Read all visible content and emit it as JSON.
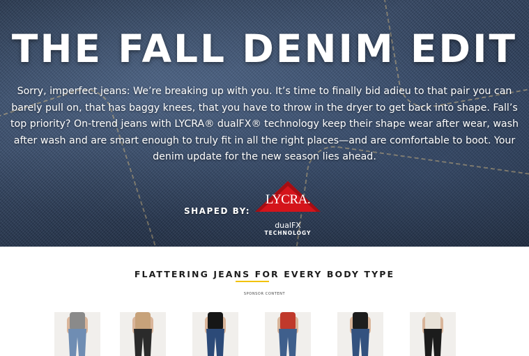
{
  "hero": {
    "title": "THE FALL DENIM EDIT",
    "body": "Sorry, imperfect jeans: We’re breaking up with you. It’s time to finally bid adieu to that pair you can barely pull on, that has baggy knees, that you have to throw in the dryer to get back into shape. Fall’s top priority? On-trend jeans with LYCRA® dualFX® technology keep their shape wear after wear, wash after wash and are smart enough to truly fit in all the right places—and are comfortable to boot. Your denim update for the new season lies ahead.",
    "shaped_by": "SHAPED BY:",
    "logo": {
      "brand": "LYCRA.",
      "line1": "dualFX",
      "line2": "TECHNOLOGY",
      "color": "#d4141b"
    }
  },
  "section": {
    "title": "FLATTERING JEANS FOR EVERY BODY TYPE",
    "sponsor": "SPONSOR CONTENT",
    "accent": "#f2c200"
  },
  "products": [
    {
      "name": "product-1",
      "top_color": "#8a8a8a",
      "jean_color": "#6f8db3"
    },
    {
      "name": "product-2",
      "top_color": "#c7a27a",
      "jean_color": "#2b2b2b"
    },
    {
      "name": "product-3",
      "top_color": "#161616",
      "jean_color": "#2c4a78"
    },
    {
      "name": "product-4",
      "top_color": "#c0392b",
      "jean_color": "#3f5f8c"
    },
    {
      "name": "product-5",
      "top_color": "#1d1d1d",
      "jean_color": "#33527f"
    },
    {
      "name": "product-6",
      "top_color": "#e8e2d8",
      "jean_color": "#1c1c1c"
    }
  ]
}
